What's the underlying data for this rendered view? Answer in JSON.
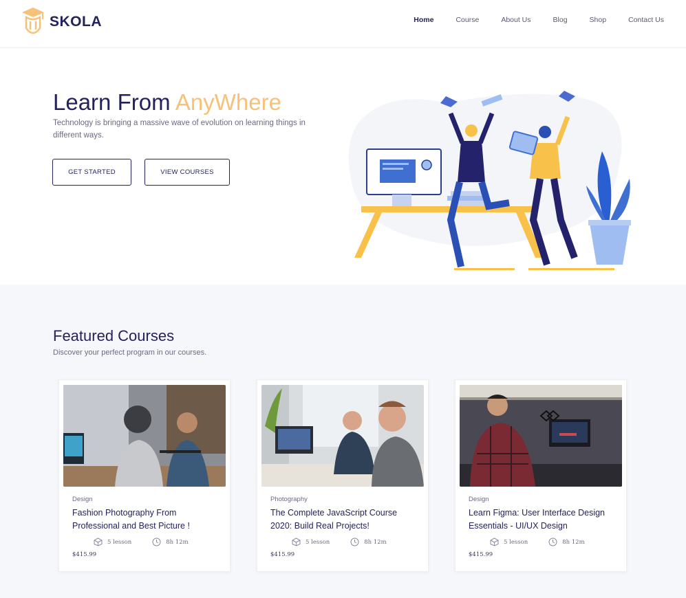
{
  "brand": {
    "name": "SKOLA",
    "accent_color": "#f8c179",
    "primary_color": "#23225b"
  },
  "nav": {
    "items": [
      {
        "label": "Home",
        "active": true
      },
      {
        "label": "Course",
        "active": false
      },
      {
        "label": "About Us",
        "active": false
      },
      {
        "label": "Blog",
        "active": false
      },
      {
        "label": "Shop",
        "active": false
      },
      {
        "label": "Contact Us",
        "active": false
      }
    ]
  },
  "hero": {
    "title_part1": "Learn From ",
    "title_accent": "AnyWhere",
    "subtitle": "Technology is bringing a massive wave of evolution on learning things in different ways.",
    "btn_start": "GET STARTED",
    "btn_courses": "VIEW COURSES"
  },
  "featured": {
    "title": "Featured Courses",
    "subtitle": "Discover your perfect program in our courses.",
    "courses": [
      {
        "category": "Design",
        "title": "Fashion Photography From Professional and Best Picture !",
        "lessons": "5 lesson",
        "duration": "8h 12m",
        "price": "$415.99",
        "image_icon": "podcast-photo"
      },
      {
        "category": "Photography",
        "title": "The Complete JavaScript Course 2020: Build Real Projects!",
        "lessons": "5 lesson",
        "duration": "8h 12m",
        "price": "$415.99",
        "image_icon": "office-photo"
      },
      {
        "category": "Design",
        "title": "Learn Figma: User Interface Design Essentials - UI/UX Design",
        "lessons": "5 lesson",
        "duration": "8h 12m",
        "price": "$415.99",
        "image_icon": "desk-photo"
      }
    ]
  }
}
